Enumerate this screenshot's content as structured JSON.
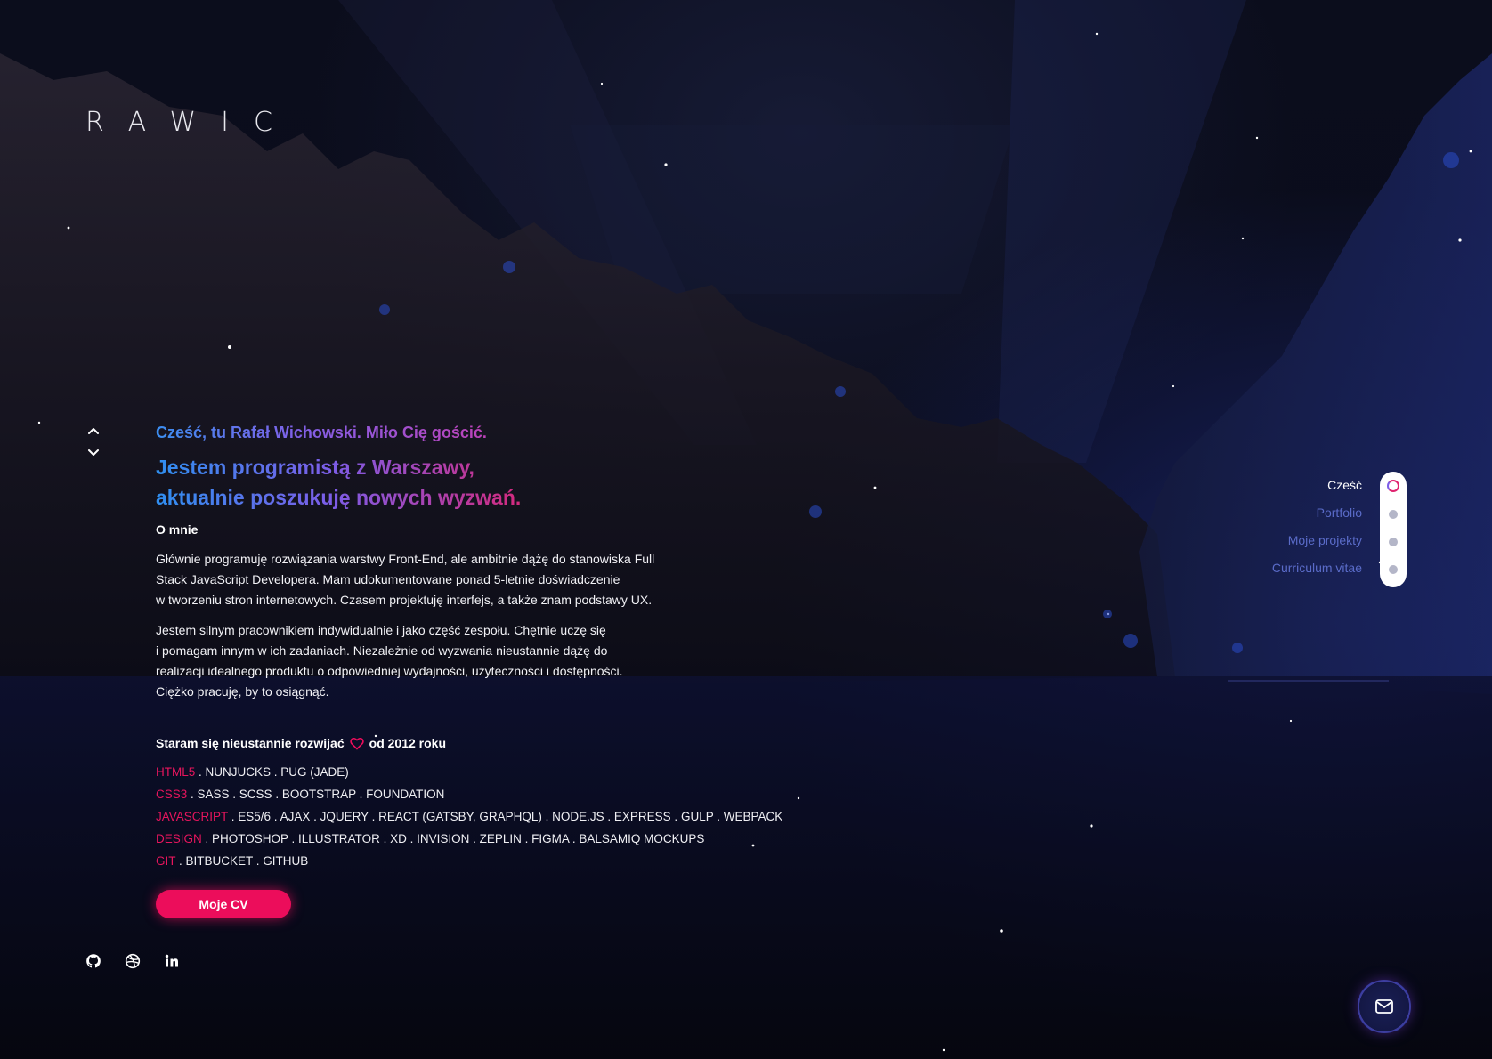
{
  "brand": {
    "logo_text": "RAWIC"
  },
  "hero": {
    "greeting": "Cześć, tu Rafał Wichowski. Miło Cię gościć.",
    "headline_line1": "Jestem programistą z Warszawy,",
    "headline_line2": "aktualnie poszukuję nowych wyzwań."
  },
  "about": {
    "title": "O mnie",
    "paragraph1_line1": "Głównie programuję rozwiązania warstwy Front-End, ale ambitnie dążę do stanowiska Full",
    "paragraph1_line2": "Stack JavaScript Developera. Mam udokumentowane ponad 5-letnie doświadczenie",
    "paragraph1_line3": "w tworzeniu stron internetowych. Czasem projektuję interfejs, a także znam podstawy UX.",
    "paragraph2_line1": "Jestem silnym pracownikiem indywidualnie i jako część zespołu. Chętnie uczę się",
    "paragraph2_line2": "i pomagam innym w ich zadaniach. Niezależnie od wyzwania nieustannie dążę do",
    "paragraph2_line3": "realizacji idealnego produktu o odpowiedniej wydajności, użyteczności i dostępności.",
    "paragraph2_line4": "Ciężko pracuję, by to osiągnąć."
  },
  "skills": {
    "title_before": "Staram się nieustannie rozwijać",
    "title_after": "od 2012 roku",
    "items": [
      {
        "tech": "HTML5",
        "details": " . NUNJUCKS . PUG (JADE)"
      },
      {
        "tech": "CSS3",
        "details": " . SASS . SCSS . BOOTSTRAP . FOUNDATION"
      },
      {
        "tech": "JAVASCRIPT",
        "details": " . ES5/6 . AJAX . JQUERY . REACT (GATSBY, GRAPHQL) . NODE.JS . EXPRESS . GULP . WEBPACK"
      },
      {
        "tech": "DESIGN",
        "details": " . PHOTOSHOP . ILLUSTRATOR . XD . INVISION . ZEPLIN . FIGMA . BALSAMIQ MOCKUPS"
      },
      {
        "tech": "GIT",
        "details": " . BITBUCKET . GITHUB"
      }
    ]
  },
  "cv_button": {
    "label": "Moje CV"
  },
  "socials": {
    "icons": [
      "github-icon",
      "dribbble-icon",
      "linkedin-icon"
    ]
  },
  "side_nav": {
    "items": [
      {
        "label": "Cześć",
        "active": true
      },
      {
        "label": "Portfolio",
        "active": false
      },
      {
        "label": "Moje projekty",
        "active": false
      },
      {
        "label": "Curriculum vitae",
        "active": false
      }
    ]
  },
  "colors": {
    "accent_pink": "#ec0d5b",
    "accent_blue": "#2f8ff0",
    "accent_purple": "#7d5de7",
    "nav_inactive": "#5a6bc8"
  }
}
